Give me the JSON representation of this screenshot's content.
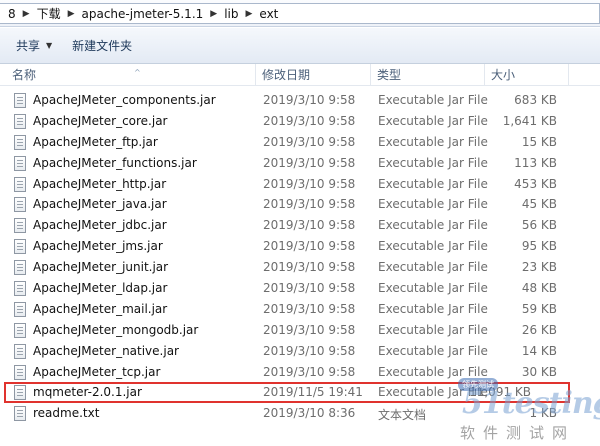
{
  "breadcrumb": [
    "8",
    "下载",
    "apache-jmeter-5.1.1",
    "lib",
    "ext"
  ],
  "toolbar": {
    "share_label": "共享",
    "new_folder_label": "新建文件夹"
  },
  "columns": {
    "name": "名称",
    "date": "修改日期",
    "type": "类型",
    "size": "大小"
  },
  "files": [
    {
      "name": "ApacheJMeter_components.jar",
      "date": "2019/3/10 9:58",
      "type": "Executable Jar File",
      "size": "683 KB"
    },
    {
      "name": "ApacheJMeter_core.jar",
      "date": "2019/3/10 9:58",
      "type": "Executable Jar File",
      "size": "1,641 KB"
    },
    {
      "name": "ApacheJMeter_ftp.jar",
      "date": "2019/3/10 9:58",
      "type": "Executable Jar File",
      "size": "15 KB"
    },
    {
      "name": "ApacheJMeter_functions.jar",
      "date": "2019/3/10 9:58",
      "type": "Executable Jar File",
      "size": "113 KB"
    },
    {
      "name": "ApacheJMeter_http.jar",
      "date": "2019/3/10 9:58",
      "type": "Executable Jar File",
      "size": "453 KB"
    },
    {
      "name": "ApacheJMeter_java.jar",
      "date": "2019/3/10 9:58",
      "type": "Executable Jar File",
      "size": "45 KB"
    },
    {
      "name": "ApacheJMeter_jdbc.jar",
      "date": "2019/3/10 9:58",
      "type": "Executable Jar File",
      "size": "56 KB"
    },
    {
      "name": "ApacheJMeter_jms.jar",
      "date": "2019/3/10 9:58",
      "type": "Executable Jar File",
      "size": "95 KB"
    },
    {
      "name": "ApacheJMeter_junit.jar",
      "date": "2019/3/10 9:58",
      "type": "Executable Jar File",
      "size": "23 KB"
    },
    {
      "name": "ApacheJMeter_ldap.jar",
      "date": "2019/3/10 9:58",
      "type": "Executable Jar File",
      "size": "48 KB"
    },
    {
      "name": "ApacheJMeter_mail.jar",
      "date": "2019/3/10 9:58",
      "type": "Executable Jar File",
      "size": "59 KB"
    },
    {
      "name": "ApacheJMeter_mongodb.jar",
      "date": "2019/3/10 9:58",
      "type": "Executable Jar File",
      "size": "26 KB"
    },
    {
      "name": "ApacheJMeter_native.jar",
      "date": "2019/3/10 9:58",
      "type": "Executable Jar File",
      "size": "14 KB"
    },
    {
      "name": "ApacheJMeter_tcp.jar",
      "date": "2019/3/10 9:58",
      "type": "Executable Jar File",
      "size": "30 KB"
    },
    {
      "name": "mqmeter-2.0.1.jar",
      "date": "2019/11/5 19:41",
      "type": "Executable Jar File",
      "size": "11,091 KB"
    },
    {
      "name": "readme.txt",
      "date": "2019/3/10 8:36",
      "type": "文本文档",
      "size": "1 KB"
    }
  ],
  "icons": {
    "file": "document-icon",
    "caret": "chevron-down-icon"
  },
  "watermark": {
    "logo": "51testing",
    "text": "软件测试网",
    "badge": "领先测试"
  },
  "colors": {
    "highlight": "#e0332e",
    "toolbar_text": "#1e395b"
  }
}
